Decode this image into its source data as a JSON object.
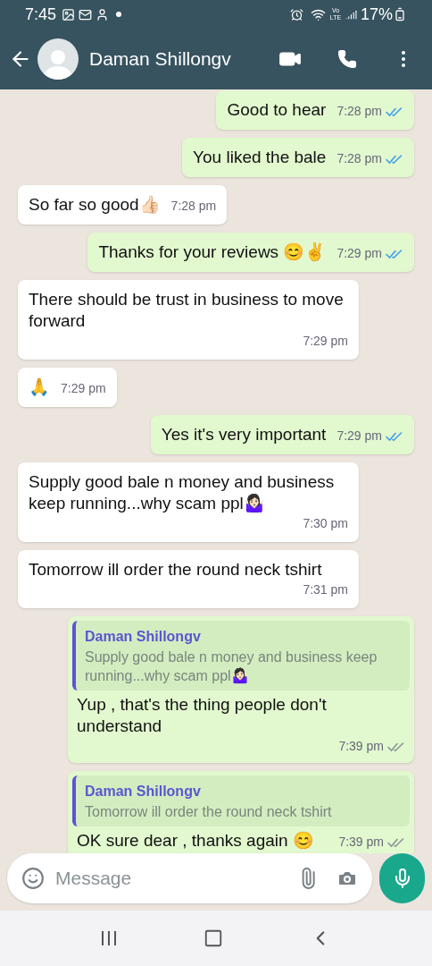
{
  "status_bar": {
    "time": "7:45",
    "network_label": "Vo LTE",
    "battery": "17%"
  },
  "header": {
    "contact": "Daman Shillongv"
  },
  "messages": [
    {
      "kind": "text",
      "outgoing": true,
      "text": "Good to hear",
      "time": "7:28 pm",
      "read": true
    },
    {
      "kind": "text",
      "outgoing": true,
      "text": "You liked the bale",
      "time": "7:28 pm",
      "read": true
    },
    {
      "kind": "text",
      "outgoing": false,
      "text": "So far so good👍🏻",
      "time": "7:28 pm"
    },
    {
      "kind": "text",
      "outgoing": true,
      "text": "Thanks for your reviews 😊✌️",
      "time": "7:29 pm",
      "read": true
    },
    {
      "kind": "text",
      "outgoing": false,
      "text": "There should be trust in business to move forward",
      "time": "7:29 pm"
    },
    {
      "kind": "text",
      "outgoing": false,
      "text": "🙏",
      "time": "7:29 pm"
    },
    {
      "kind": "text",
      "outgoing": true,
      "text": "Yes it's very important",
      "time": "7:29 pm",
      "read": true
    },
    {
      "kind": "text",
      "outgoing": false,
      "text": "Supply good bale n money and business keep running...why scam ppl🤷🏻‍♀️",
      "time": "7:30 pm"
    },
    {
      "kind": "text",
      "outgoing": false,
      "text": "Tomorrow ill order the round neck tshirt",
      "time": "7:31 pm"
    },
    {
      "kind": "reply",
      "outgoing": true,
      "quote_author": "Daman Shillongv",
      "quote_text": "Supply good bale n money and business keep running...why scam ppl🤷🏻‍♀️",
      "text": "Yup , that's the thing people don't understand",
      "time": "7:39 pm",
      "read": false
    },
    {
      "kind": "reply",
      "outgoing": true,
      "quote_author": "Daman Shillongv",
      "quote_text": "Tomorrow ill order the round neck tshirt",
      "text": "OK sure dear , thanks again 😊",
      "time": "7:39 pm",
      "read": false
    }
  ],
  "composer": {
    "placeholder": "Message"
  }
}
